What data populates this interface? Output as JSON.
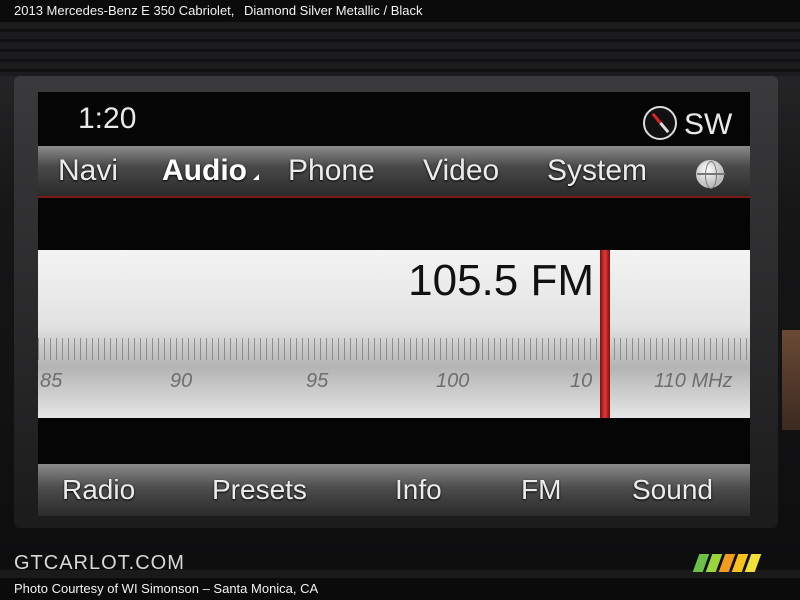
{
  "caption": {
    "vehicle": "2013 Mercedes-Benz E 350 Cabriolet,",
    "color": "Diamond Silver Metallic / Black"
  },
  "status": {
    "time": "1:20",
    "heading": "SW"
  },
  "tabs": [
    {
      "label": "Navi",
      "active": false
    },
    {
      "label": "Audio",
      "active": true
    },
    {
      "label": "Phone",
      "active": false
    },
    {
      "label": "Video",
      "active": false
    },
    {
      "label": "System",
      "active": false
    }
  ],
  "tuner": {
    "frequency": "105.5 FM",
    "scale_labels": [
      "85",
      "90",
      "95",
      "100",
      "10",
      "110 MHz"
    ]
  },
  "bottom_buttons": [
    {
      "label": "Radio"
    },
    {
      "label": "Presets"
    },
    {
      "label": "Info"
    },
    {
      "label": "FM"
    },
    {
      "label": "Sound"
    }
  ],
  "footer": {
    "watermark": "GTCARLOT.COM",
    "credit": "Photo Courtesy of WI Simonson – Santa Monica, CA"
  },
  "colors": {
    "needle": "#e23a3a",
    "stripes": [
      "#6cc04a",
      "#9ad53c",
      "#f39c1f",
      "#f7c21d",
      "#f2e03a"
    ]
  },
  "icons": [
    "compass-icon",
    "globe-icon"
  ]
}
